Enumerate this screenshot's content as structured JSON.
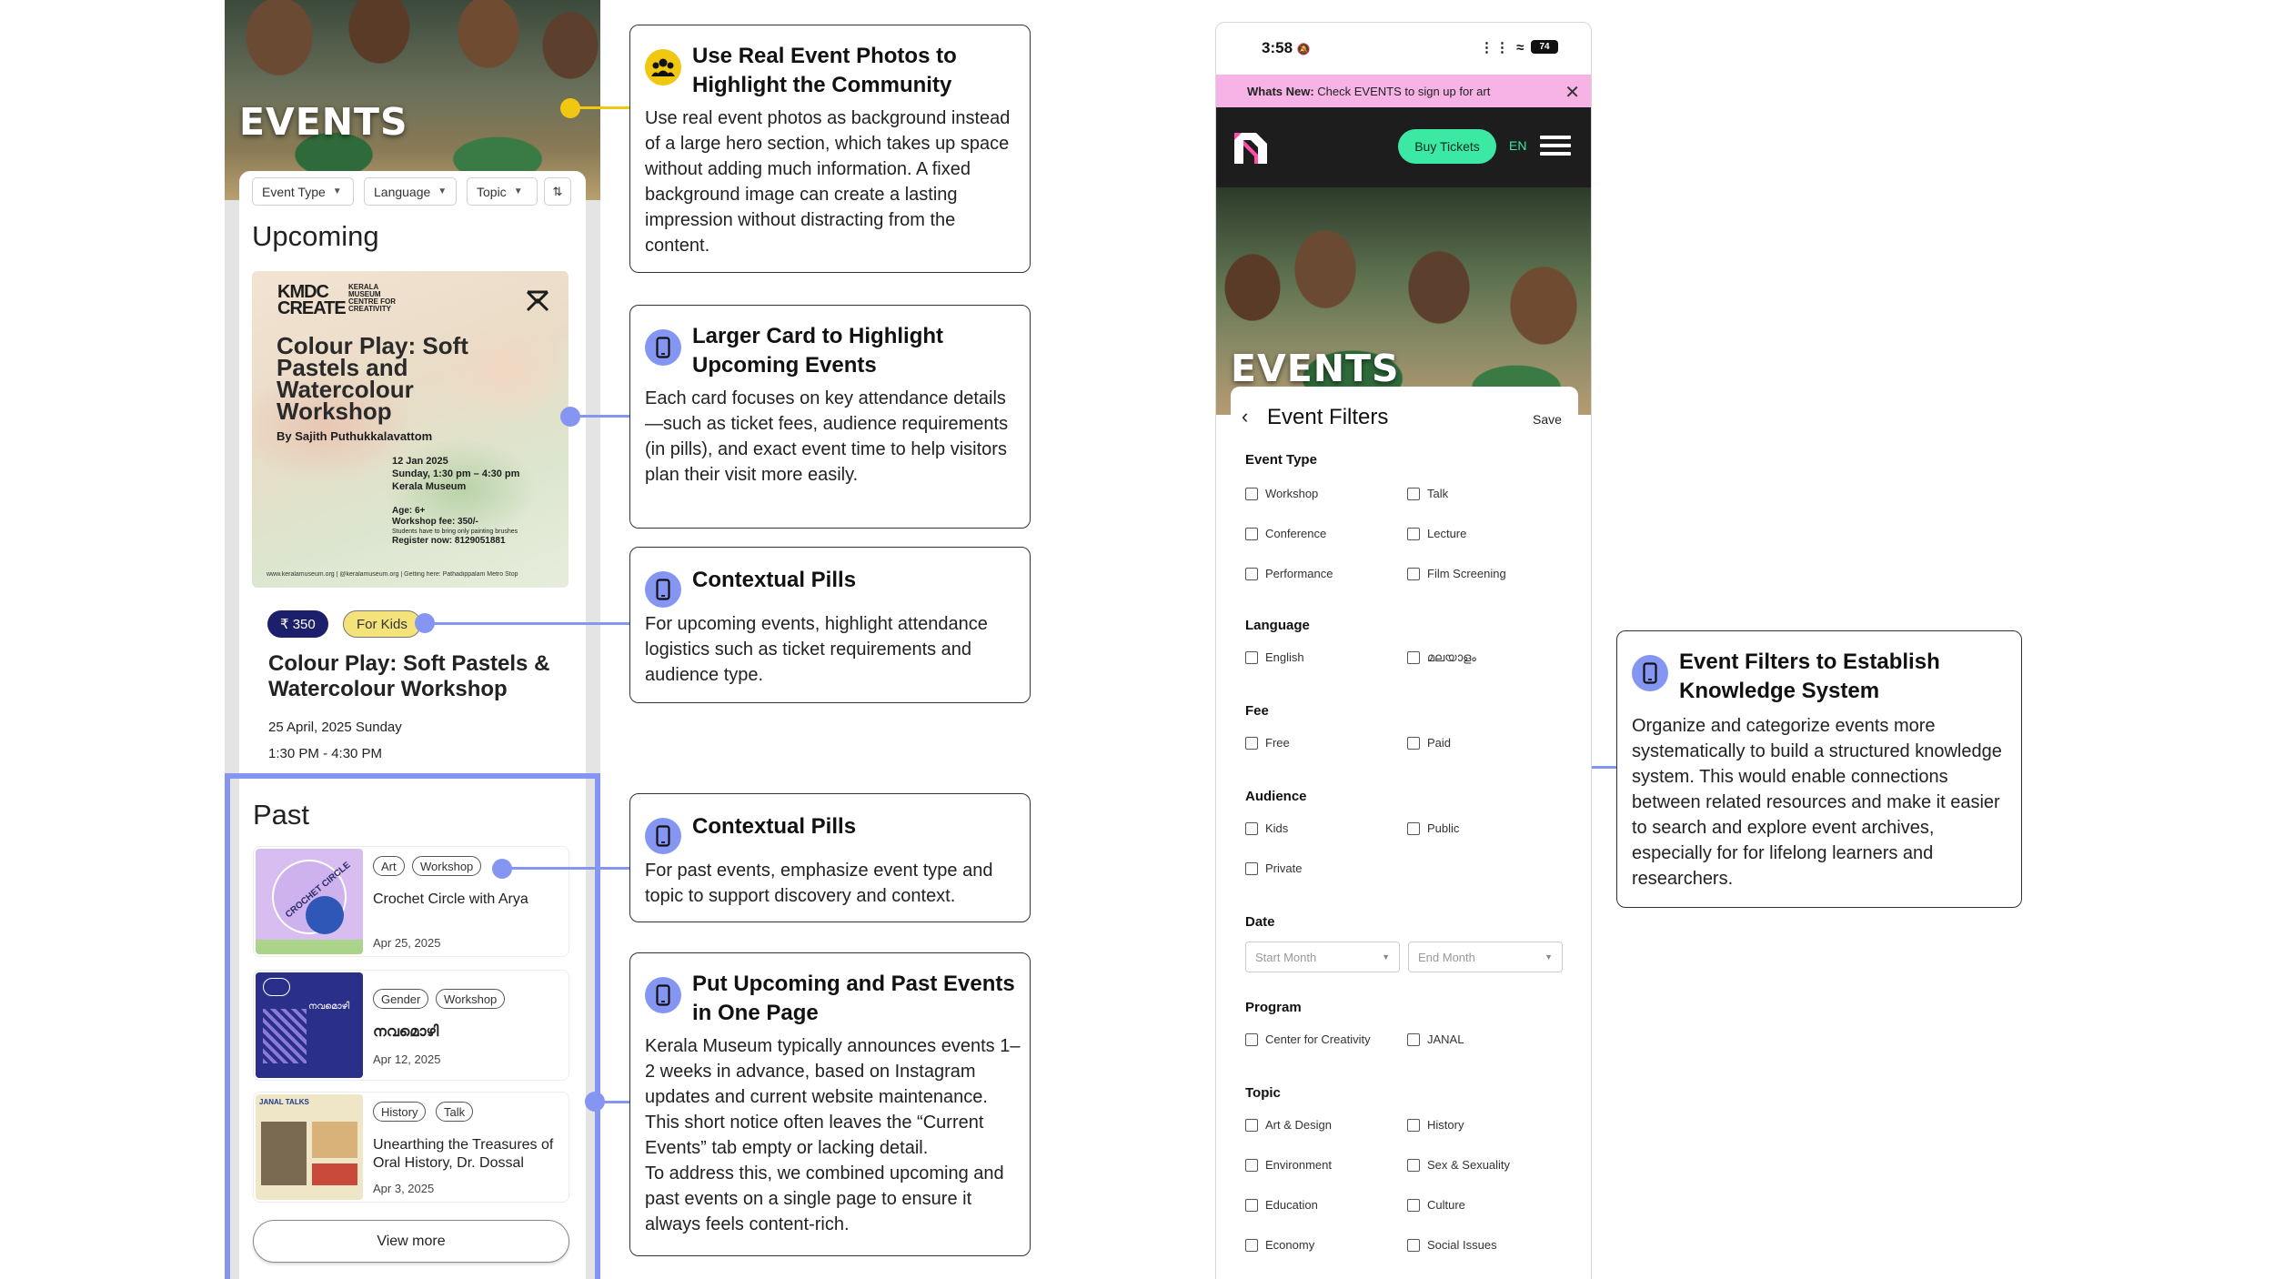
{
  "left_phone": {
    "hero_title": "EVENTS",
    "filters": [
      {
        "label": "Event Type"
      },
      {
        "label": "Language"
      },
      {
        "label": "Topic"
      }
    ],
    "sort_icon": "sort-icon",
    "upcoming_heading": "Upcoming",
    "poster": {
      "logo": "KMDC\nCREATE",
      "logo_sub": "KERALA MUSEUM CENTRE FOR CREATIVITY",
      "title": "Colour Play: Soft Pastels and Watercolour Workshop",
      "author": "By Sajith Puthukkalavattom",
      "date_line": "12 Jan 2025",
      "time_line": "Sunday, 1:30 pm – 4:30 pm",
      "venue_line": "Kerala Museum",
      "age_line": "Age: 6+",
      "fee_line": "Workshop fee: 350/-",
      "note_line": "Students have to bring only painting brushes",
      "register_line": "Register now: 8129051881",
      "footer": "www.keralamuseum.org | @keralamuseum.org | Getting here: Pathadippalam Metro Stop"
    },
    "pill_price": "₹ 350",
    "pill_kids": "For Kids",
    "upcoming_title": "Colour Play: Soft Pastels & Watercolour Workshop",
    "upcoming_date": "25 April, 2025 Sunday",
    "upcoming_time": "1:30 PM - 4:30 PM",
    "past_heading": "Past",
    "past_items": [
      {
        "tags": [
          "Art",
          "Workshop"
        ],
        "title": "Crochet Circle with Arya",
        "date": "Apr 25, 2025",
        "thumb_text": "CROCHET CIRCLE"
      },
      {
        "tags": [
          "Gender",
          "Workshop"
        ],
        "title": "നവമൊഴി",
        "date": "Apr 12, 2025",
        "thumb_text": "നവമൊഴി"
      },
      {
        "tags": [
          "History",
          "Talk"
        ],
        "title": "Unearthing the Treasures of Oral History, Dr. Dossal",
        "date": "Apr 3, 2025",
        "thumb_text": "JANAL TALKS"
      }
    ],
    "view_more": "View more"
  },
  "notes": [
    {
      "icon": "people-icon",
      "title": "Use Real Event Photos to Highlight the Community",
      "body": "Use real event photos as background instead of a large hero section, which takes up space without adding much information. A fixed background image can create a lasting impression without distracting from the content."
    },
    {
      "icon": "phone-icon",
      "title": "Larger Card to Highlight Upcoming Events",
      "body": "Each card focuses on key attendance details—such as ticket fees, audience requirements (in pills), and exact event time to help visitors plan their visit more easily."
    },
    {
      "icon": "phone-icon",
      "title": "Contextual Pills",
      "body": "For upcoming events, highlight attendance logistics such as ticket requirements and audience type."
    },
    {
      "icon": "phone-icon",
      "title": "Contextual Pills",
      "body": "For past events, emphasize event type and topic to support discovery and context."
    },
    {
      "icon": "phone-icon",
      "title": "Put Upcoming and Past Events in One Page",
      "body": "Kerala Museum typically announces events 1–2 weeks in advance, based on Instagram updates and current website maintenance. This short notice often leaves the “Current Events” tab empty or lacking detail.\nTo address this, we combined upcoming and past events on a single page to ensure it always feels content-rich."
    },
    {
      "icon": "phone-icon",
      "title": "Event Filters to Establish Knowledge System",
      "body": "Organize and categorize events more systematically to build a structured knowledge system. This would enable connections between related resources and make it easier to search and explore event archives, especially for for lifelong learners and researchers."
    }
  ],
  "right_phone": {
    "status_time": "3:58",
    "battery": "74",
    "news_label": "Whats New:",
    "news_text": " Check EVENTS to sign up for art",
    "buy_tickets": "Buy Tickets",
    "lang": "EN",
    "hero_title": "EVENTS",
    "filters_title": "Event Filters",
    "filters_save": "Save",
    "groups": {
      "event_type": {
        "heading": "Event Type",
        "options": [
          "Workshop",
          "Talk",
          "Conference",
          "Lecture",
          "Performance",
          "Film Screening"
        ]
      },
      "language": {
        "heading": "Language",
        "options": [
          "English",
          "മലയാളം"
        ]
      },
      "fee": {
        "heading": "Fee",
        "options": [
          "Free",
          "Paid"
        ]
      },
      "audience": {
        "heading": "Audience",
        "options": [
          "Kids",
          "Public",
          "Private"
        ]
      },
      "date": {
        "heading": "Date",
        "start_placeholder": "Start Month",
        "end_placeholder": "End Month"
      },
      "program": {
        "heading": "Program",
        "options": [
          "Center for Creativity",
          "JANAL"
        ]
      },
      "topic": {
        "heading": "Topic",
        "options": [
          "Art & Design",
          "History",
          "Environment",
          "Sex & Sexuality",
          "Education",
          "Culture",
          "Economy",
          "Social Issues"
        ]
      }
    }
  },
  "colors": {
    "accent_blue": "#8596f2",
    "pill_navy": "#1c1f6b",
    "pill_yellow": "#f4e27a",
    "news_pink": "#f7b3e6",
    "ticket_green": "#3be8a4",
    "marker_yellow": "#f2c712"
  }
}
